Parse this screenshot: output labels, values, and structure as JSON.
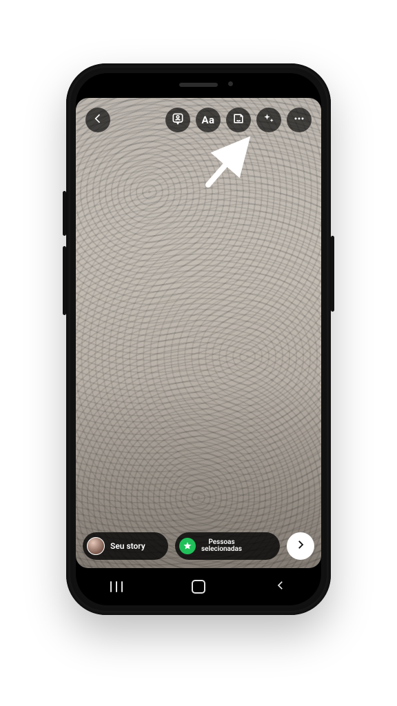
{
  "topbar": {
    "back_icon": "back-icon",
    "avatar_sticker_icon": "tag-people-icon",
    "text_tool_label": "Aa",
    "sticker_icon": "sticker-icon",
    "effects_icon": "sparkle-icon",
    "more_icon": "more-icon"
  },
  "annotation": {
    "arrow_target": "sticker-button"
  },
  "share": {
    "your_story_label": "Seu story",
    "close_friends_label_line1": "Pessoas",
    "close_friends_label_line2": "selecionadas",
    "next_icon": "chevron-right-icon"
  },
  "colors": {
    "chip_bg": "rgba(0,0,0,0.78)",
    "close_friends_badge": "#21c05a",
    "next_btn_bg": "#ffffff"
  },
  "device": {
    "nav_style": "android-3-button"
  }
}
